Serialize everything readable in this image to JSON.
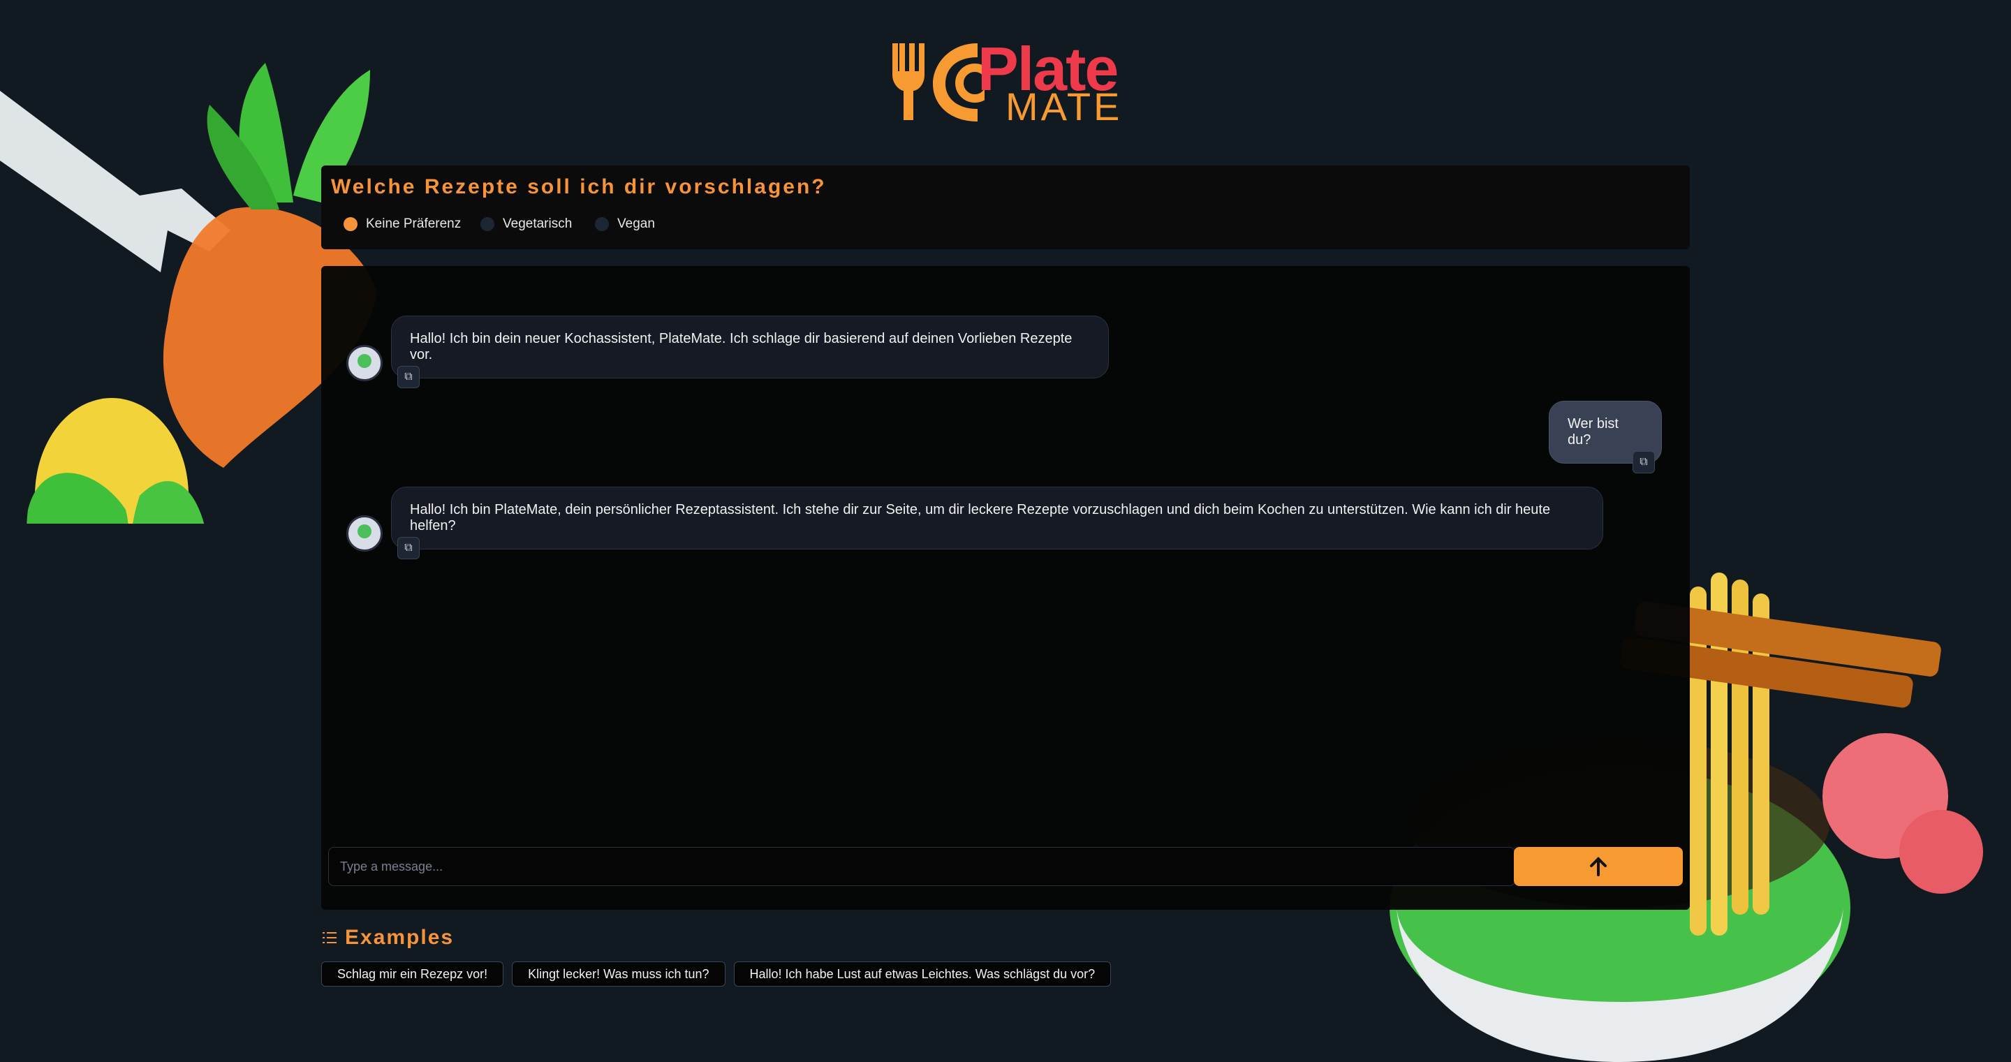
{
  "logo": {
    "text_top": "Plate",
    "text_bottom": "MATE"
  },
  "preferences": {
    "title": "Welche Rezepte soll ich dir vorschlagen?",
    "options": [
      "Keine Präferenz",
      "Vegetarisch",
      "Vegan"
    ],
    "selected": "Keine Präferenz"
  },
  "chat": {
    "messages": [
      {
        "role": "assistant",
        "text": "Hallo! Ich bin dein neuer Kochassistent, PlateMate. Ich schlage dir basierend auf deinen Vorlieben Rezepte vor."
      },
      {
        "role": "user",
        "text": "Wer bist du?"
      },
      {
        "role": "assistant",
        "text": "Hallo! Ich bin PlateMate, dein persönlicher Rezeptassistent. Ich stehe dir zur Seite, um dir leckere Rezepte vorzuschlagen und dich beim Kochen zu unterstützen. Wie kann ich dir heute helfen?"
      }
    ]
  },
  "input": {
    "placeholder": "Type a message...",
    "send_icon": "arrow-up-icon"
  },
  "examples": {
    "title": "Examples",
    "items": [
      "Schlag mir ein Rezepz vor!",
      "Klingt lecker! Was muss ich tun?",
      "Hallo! Ich habe Lust auf etwas Leichtes. Was schlägst du vor?"
    ]
  },
  "colors": {
    "accent": "#f89a32",
    "background": "#111921",
    "brand_red": "#ee3a4a"
  }
}
